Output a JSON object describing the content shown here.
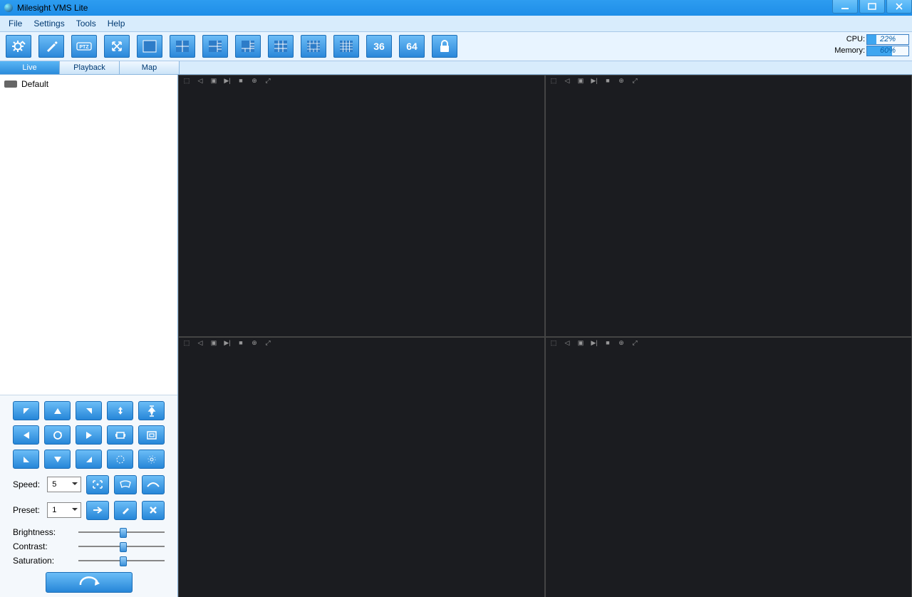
{
  "title": "Milesight VMS Lite",
  "menu": {
    "file": "File",
    "settings": "Settings",
    "tools": "Tools",
    "help": "Help"
  },
  "toolbar": {
    "settings": "settings",
    "edit": "edit",
    "ptz": "PTZ",
    "fullscreen": "fullscreen",
    "layout1": "1",
    "layout4": "2x2",
    "layout6": "6",
    "layout8": "8",
    "layout9": "3x3",
    "layout13": "13",
    "layout16": "4x4",
    "layout36": "36",
    "layout64": "64",
    "lock": "lock"
  },
  "stats": {
    "cpu_label": "CPU:",
    "cpu_value": "22%",
    "cpu_pct": 22,
    "mem_label": "Memory:",
    "mem_value": "60%",
    "mem_pct": 60
  },
  "tabs": {
    "live": "Live",
    "playback": "Playback",
    "map": "Map"
  },
  "tree": {
    "root": "Default"
  },
  "ptz": {
    "speed_label": "Speed:",
    "speed_value": "5",
    "preset_label": "Preset:",
    "preset_value": "1",
    "brightness": "Brightness:",
    "contrast": "Contrast:",
    "saturation": "Saturation:"
  },
  "video": {
    "icons": {
      "rec": "⬚",
      "mute": "◁",
      "snap": "▣",
      "next": "▶|",
      "stop": "■",
      "zoom": "⊕",
      "full": "⤢"
    }
  }
}
